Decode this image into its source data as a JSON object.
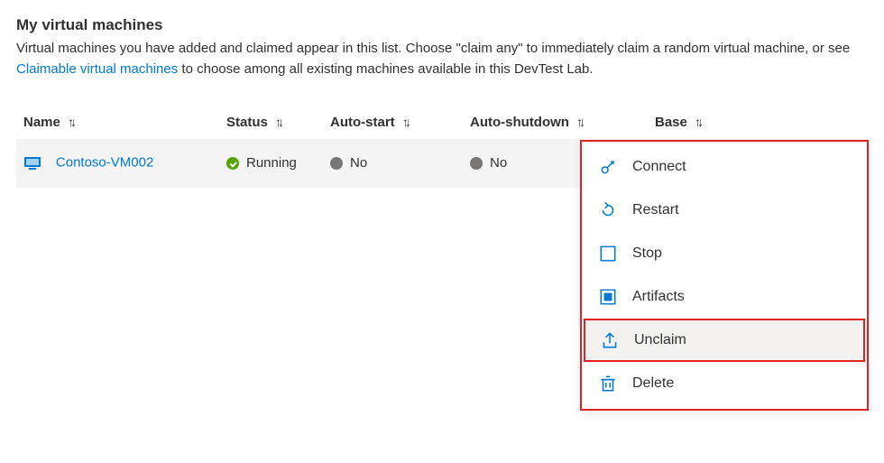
{
  "heading": "My virtual machines",
  "description_before": "Virtual machines you have added and claimed appear in this list. Choose \"claim any\" to immediately claim a random virtual machine, or see ",
  "description_link": "Claimable virtual machines",
  "description_after": " to choose among all existing machines available in this DevTest Lab.",
  "columns": {
    "name": "Name",
    "status": "Status",
    "autostart": "Auto-start",
    "autoshutdown": "Auto-shutdown",
    "base": "Base"
  },
  "rows": [
    {
      "name": "Contoso-VM002",
      "status": "Running",
      "status_color": "green",
      "autostart": "No",
      "autoshutdown": "No",
      "base": ""
    }
  ],
  "menu": {
    "connect": "Connect",
    "restart": "Restart",
    "stop": "Stop",
    "artifacts": "Artifacts",
    "unclaim": "Unclaim",
    "delete": "Delete"
  }
}
